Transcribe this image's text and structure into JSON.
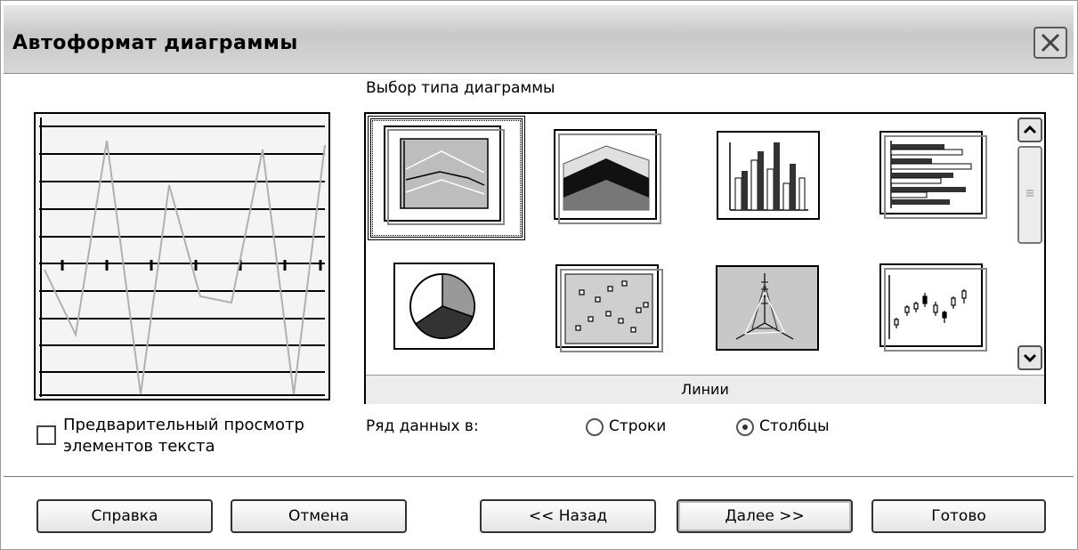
{
  "window": {
    "title": "Автоформат диаграммы",
    "close_icon": "close-icon"
  },
  "chart_type": {
    "section_label": "Выбор типа диаграммы",
    "selected_caption": "Линии",
    "types": [
      {
        "icon": "line-chart-icon",
        "selected": true
      },
      {
        "icon": "area-chart-icon",
        "selected": false
      },
      {
        "icon": "column-chart-icon",
        "selected": false
      },
      {
        "icon": "bar-chart-icon",
        "selected": false
      },
      {
        "icon": "pie-chart-icon",
        "selected": false
      },
      {
        "icon": "scatter-chart-icon",
        "selected": false
      },
      {
        "icon": "net-chart-icon",
        "selected": false
      },
      {
        "icon": "stock-chart-icon",
        "selected": false
      }
    ]
  },
  "preview": {
    "checkbox_label_line1": "Предварительный просмотр",
    "checkbox_label_line2": "элементов текста",
    "checked": false
  },
  "data_series": {
    "label": "Ряд данных в:",
    "options": [
      {
        "label": "Строки",
        "checked": false
      },
      {
        "label": "Столбцы",
        "checked": true
      }
    ]
  },
  "buttons": {
    "help": "Справка",
    "cancel": "Отмена",
    "back": "<< Назад",
    "next": "Далее >>",
    "finish": "Готово"
  }
}
